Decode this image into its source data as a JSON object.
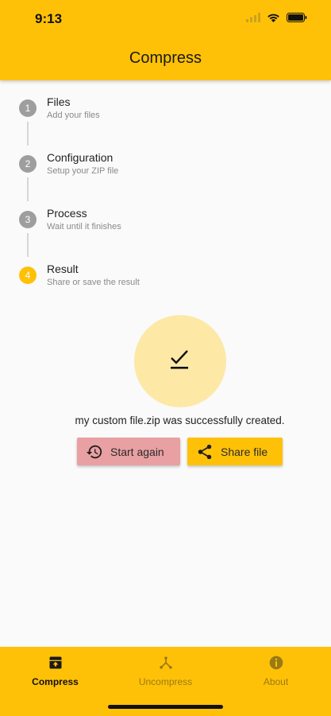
{
  "status_bar": {
    "time": "9:13"
  },
  "app_bar": {
    "title": "Compress"
  },
  "steps": [
    {
      "number": "1",
      "title": "Files",
      "subtitle": "Add your files",
      "state": "done"
    },
    {
      "number": "2",
      "title": "Configuration",
      "subtitle": "Setup your ZIP file",
      "state": "done"
    },
    {
      "number": "3",
      "title": "Process",
      "subtitle": "Wait until it finishes",
      "state": "done"
    },
    {
      "number": "4",
      "title": "Result",
      "subtitle": "Share or save the result",
      "state": "active"
    }
  ],
  "result": {
    "icon": "done-check-icon",
    "message": "my custom file.zip was successfully created."
  },
  "actions": {
    "start_again_label": "Start again",
    "start_again_icon": "history-icon",
    "share_label": "Share file",
    "share_icon": "share-icon"
  },
  "bottom_nav": {
    "items": [
      {
        "label": "Compress",
        "icon": "archive-icon",
        "active": true
      },
      {
        "label": "Uncompress",
        "icon": "unarchive-icon",
        "active": false
      },
      {
        "label": "About",
        "icon": "info-icon",
        "active": false
      }
    ]
  },
  "colors": {
    "primary": "#ffc107",
    "step_inactive": "#9e9e9e",
    "result_bg": "#fde8a6",
    "start_again_bg": "#e8a0a3"
  }
}
